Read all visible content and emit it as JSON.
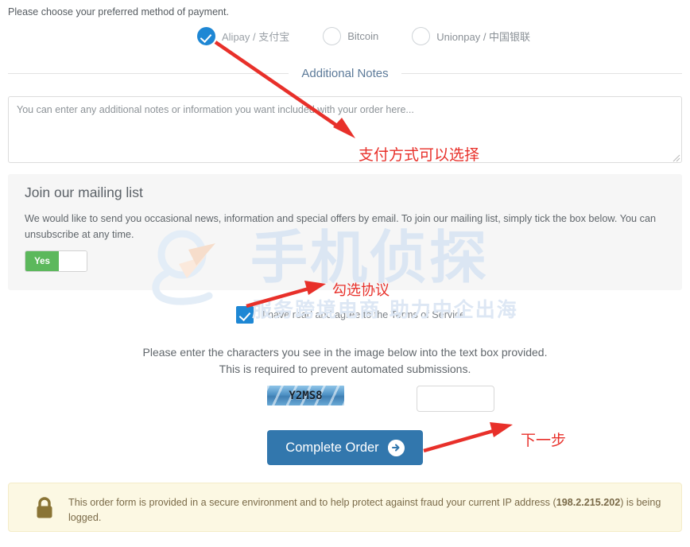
{
  "payment": {
    "prompt": "Please choose your preferred method of payment.",
    "options": [
      {
        "label": "Alipay / 支付宝",
        "selected": true
      },
      {
        "label": "Bitcoin",
        "selected": false
      },
      {
        "label": "Unionpay / 中国银联",
        "selected": false
      }
    ]
  },
  "notes": {
    "divider_title": "Additional Notes",
    "placeholder": "You can enter any additional notes or information you want included with your order here...",
    "value": ""
  },
  "mailing_list": {
    "title": "Join our mailing list",
    "description": "We would like to send you occasional news, information and special offers by email. To join our mailing list, simply tick the box below. You can unsubscribe at any time.",
    "toggle_on_label": "Yes",
    "toggle_state": "on"
  },
  "terms": {
    "label_prefix": "I have read and agree to the ",
    "link_text": "Terms of Service",
    "checked": true
  },
  "captcha": {
    "instruction_line1": "Please enter the characters you see in the image below into the text box provided.",
    "instruction_line2": "This is required to prevent automated submissions.",
    "code": "Y2MS8",
    "input_value": "",
    "input_placeholder": ""
  },
  "submit": {
    "label": "Complete Order",
    "icon": "arrow-right-circle-icon"
  },
  "secure_notice": {
    "icon": "lock-icon",
    "text_before_ip": "This order form is provided in a secure environment and to help protect against fraud your current IP address (",
    "ip_address": "198.2.215.202",
    "text_after_ip": ") is being logged."
  },
  "annotations": {
    "payment": "支付方式可以选择",
    "terms": "勾选协议",
    "next_step": "下一步"
  },
  "watermark": {
    "main": "手机侦探",
    "sub": "服务跨境电商 助力中企出海"
  },
  "colors": {
    "accent_blue": "#1e87d4",
    "button_blue": "#3277ad",
    "toggle_green": "#5cb85c",
    "notice_bg": "#fcf8e3",
    "annotation_red": "#e8302a"
  }
}
